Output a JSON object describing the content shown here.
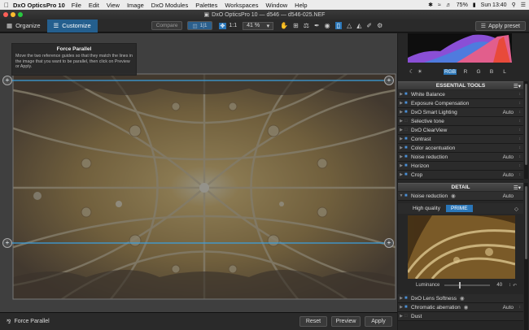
{
  "menubar": {
    "app_name": "DxO OpticsPro 10",
    "items": [
      "File",
      "Edit",
      "View",
      "Image",
      "DxO Modules",
      "Palettes",
      "Workspaces",
      "Window",
      "Help"
    ],
    "battery": "75%",
    "clock": "Sun 13:40"
  },
  "window": {
    "title": "DxO OpticsPro 10 — d546 — d546-025.NEF"
  },
  "toolbar": {
    "tab_organize": "Organize",
    "tab_customize": "Customize",
    "compare_label": "Compare",
    "split_label": "1|1",
    "one_to_one": "1:1",
    "zoom_value": "41 %",
    "apply_preset": "Apply preset"
  },
  "viewer": {
    "tooltip_title": "Force Parallel",
    "tooltip_text": "Move the two reference guides so that they match the lines in the image that you want to be parallel, then click on Preview or Apply."
  },
  "bottombar": {
    "tool_label": "Force Parallel",
    "reset": "Reset",
    "preview": "Preview",
    "apply": "Apply"
  },
  "panel": {
    "channels": [
      "RGB",
      "R",
      "G",
      "B",
      "L"
    ],
    "selected_channel": "RGB",
    "essential_header": "ESSENTIAL TOOLS",
    "tools": [
      {
        "label": "White Balance",
        "value": ""
      },
      {
        "label": "Exposure Compensation",
        "value": ""
      },
      {
        "label": "DxO Smart Lighting",
        "value": "Auto"
      },
      {
        "label": "Selective tone",
        "value": ""
      },
      {
        "label": "DxO ClearView",
        "value": ""
      },
      {
        "label": "Contrast",
        "value": ""
      },
      {
        "label": "Color accentuation",
        "value": ""
      },
      {
        "label": "Noise reduction",
        "value": "Auto"
      },
      {
        "label": "Horizon",
        "value": ""
      },
      {
        "label": "Crop",
        "value": "Auto"
      }
    ],
    "detail_header": "DETAIL",
    "detail_noise": {
      "label": "Noise reduction",
      "value": "Auto"
    },
    "high_quality": "High quality",
    "prime": "PRIME",
    "luminance_label": "Luminance",
    "luminance_value": "40",
    "detail_tools": [
      {
        "label": "DxO Lens Softness",
        "value": ""
      },
      {
        "label": "Chromatic aberration",
        "value": "Auto"
      },
      {
        "label": "Dust",
        "value": ""
      }
    ]
  },
  "colors": {
    "accent": "#2a76b8",
    "customize_tab": "#245f8e",
    "guide_line": "#3aa0e0"
  }
}
